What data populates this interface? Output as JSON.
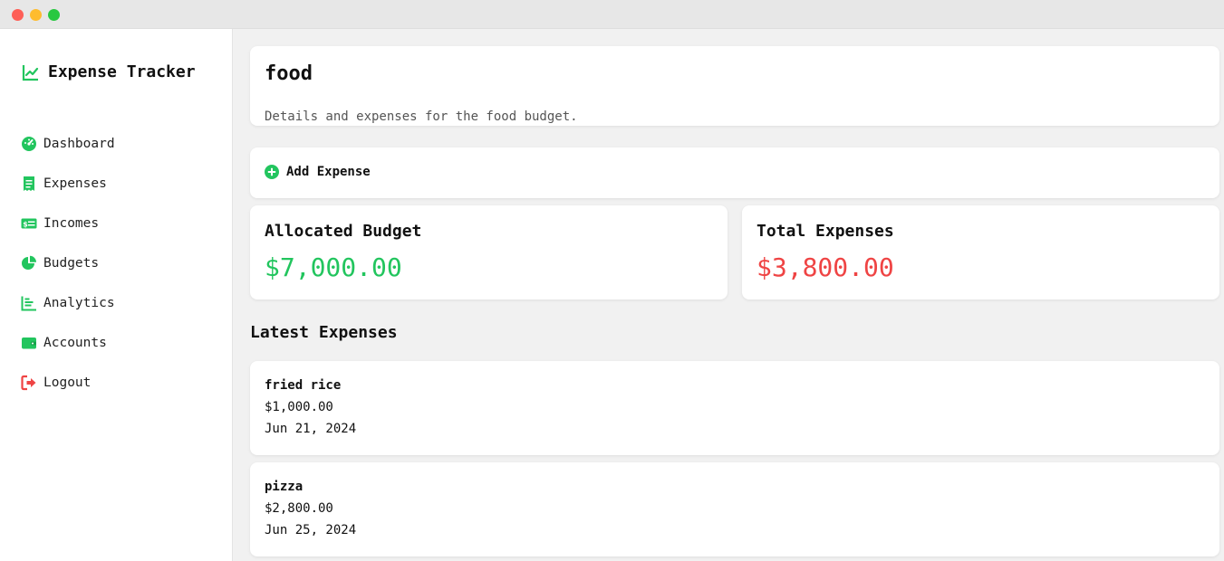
{
  "app": {
    "title": "Expense Tracker",
    "accent": "#22c55e",
    "danger": "#ef4444"
  },
  "sidebar": {
    "items": [
      {
        "label": "Dashboard",
        "icon": "gauge-icon"
      },
      {
        "label": "Expenses",
        "icon": "receipt-icon"
      },
      {
        "label": "Incomes",
        "icon": "money-bill-icon"
      },
      {
        "label": "Budgets",
        "icon": "pie-chart-icon"
      },
      {
        "label": "Analytics",
        "icon": "bar-chart-icon"
      },
      {
        "label": "Accounts",
        "icon": "wallet-icon"
      },
      {
        "label": "Logout",
        "icon": "logout-icon"
      }
    ]
  },
  "header": {
    "title": "food",
    "subtitle": "Details and expenses for the food budget."
  },
  "actions": {
    "add_expense": "Add Expense"
  },
  "stats": {
    "budget_label": "Allocated Budget",
    "budget_value": "$7,000.00",
    "expenses_label": "Total Expenses",
    "expenses_value": "$3,800.00"
  },
  "latest": {
    "title": "Latest Expenses",
    "items": [
      {
        "name": "fried rice",
        "amount": "$1,000.00",
        "date": "Jun 21, 2024"
      },
      {
        "name": "pizza",
        "amount": "$2,800.00",
        "date": "Jun 25, 2024"
      }
    ]
  }
}
